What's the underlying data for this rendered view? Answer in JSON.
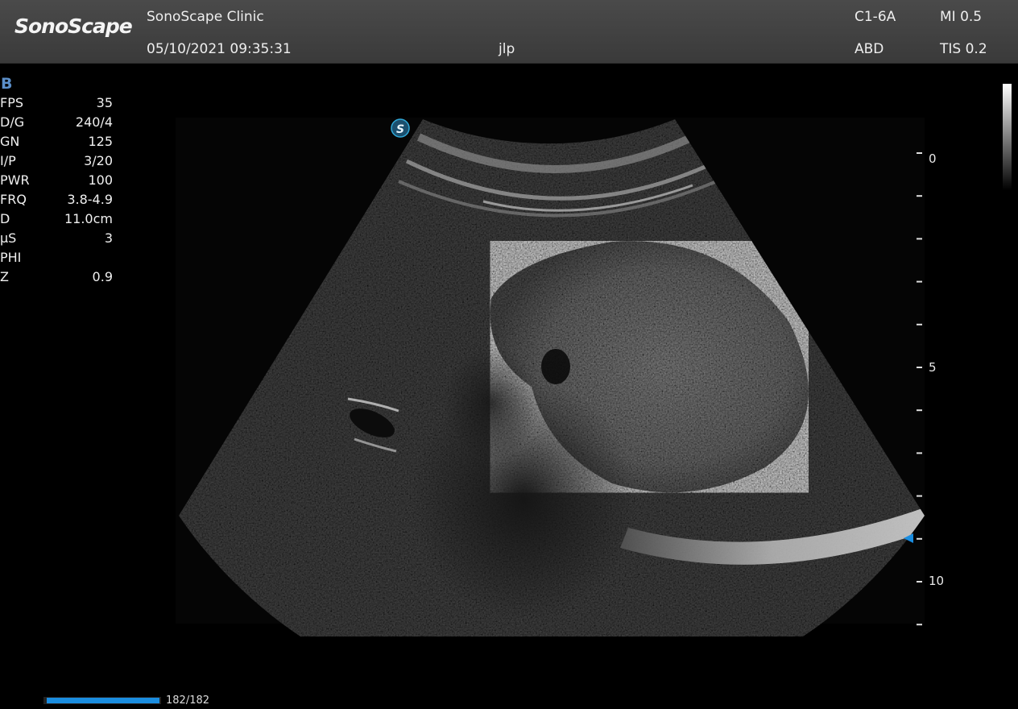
{
  "header": {
    "logo": "SonoScape",
    "clinic": "SonoScape Clinic",
    "datetime": "05/10/2021 09:35:31",
    "operator": "jlp",
    "probe": "C1-6A",
    "preset": "ABD",
    "mi": "MI 0.5",
    "tis": "TIS 0.2"
  },
  "params": {
    "mode": "B",
    "rows": [
      {
        "name": "FPS",
        "value": "35"
      },
      {
        "name": "D/G",
        "value": "240/4"
      },
      {
        "name": "GN",
        "value": "125"
      },
      {
        "name": "I/P",
        "value": "3/20"
      },
      {
        "name": "PWR",
        "value": "100"
      },
      {
        "name": "FRQ",
        "value": "3.8-4.9"
      },
      {
        "name": "D",
        "value": "11.0cm"
      },
      {
        "name": "µS",
        "value": "3"
      },
      {
        "name": "PHI",
        "value": ""
      },
      {
        "name": "Z",
        "value": "0.9"
      }
    ]
  },
  "depth_scale": {
    "labels": [
      "0",
      "5",
      "10"
    ]
  },
  "orientation_marker": "S",
  "cine": {
    "text": "182/182",
    "progress": 1.0
  },
  "colors": {
    "header_bg": "#444444",
    "mode_color": "#5b8fc9",
    "cine_fill": "#1a8de0",
    "focus_marker": "#1a8de0",
    "orientation_marker": "#2fa8d8"
  }
}
